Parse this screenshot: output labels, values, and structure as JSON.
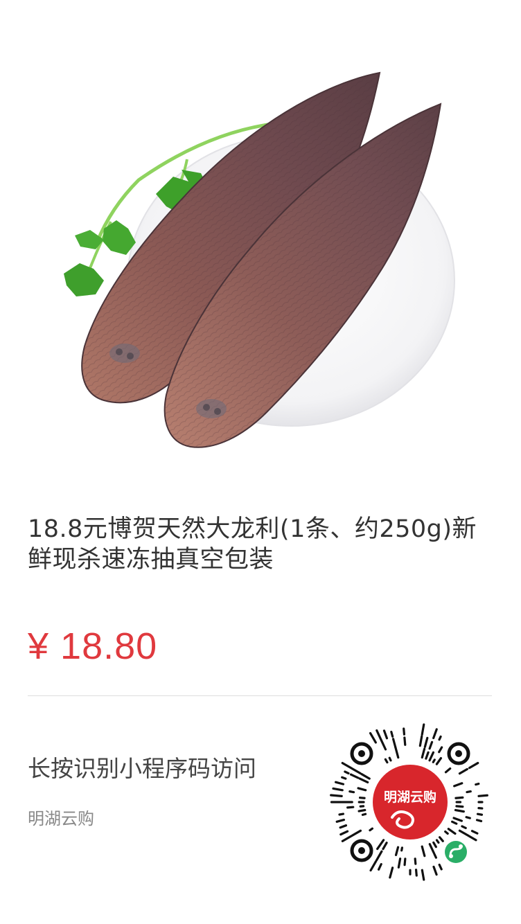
{
  "product": {
    "title": "18.8元博贺天然大龙利(1条、约250g)新鲜现杀速冻抽真空包装",
    "price": "¥ 18.80"
  },
  "footer": {
    "hint": "长按识别小程序码访问",
    "shop_name": "明湖云购",
    "qr_logo_text": "明湖云购"
  },
  "icons": {
    "product_photo": "fish-fillet-plate-image",
    "qr_code": "mini-program-qr-code",
    "wechat_badge": "wechat-mini-program-icon"
  },
  "colors": {
    "price": "#e0393e",
    "qr_logo": "#d8262c",
    "divider": "#dddddd",
    "badge": "#2aae67"
  }
}
